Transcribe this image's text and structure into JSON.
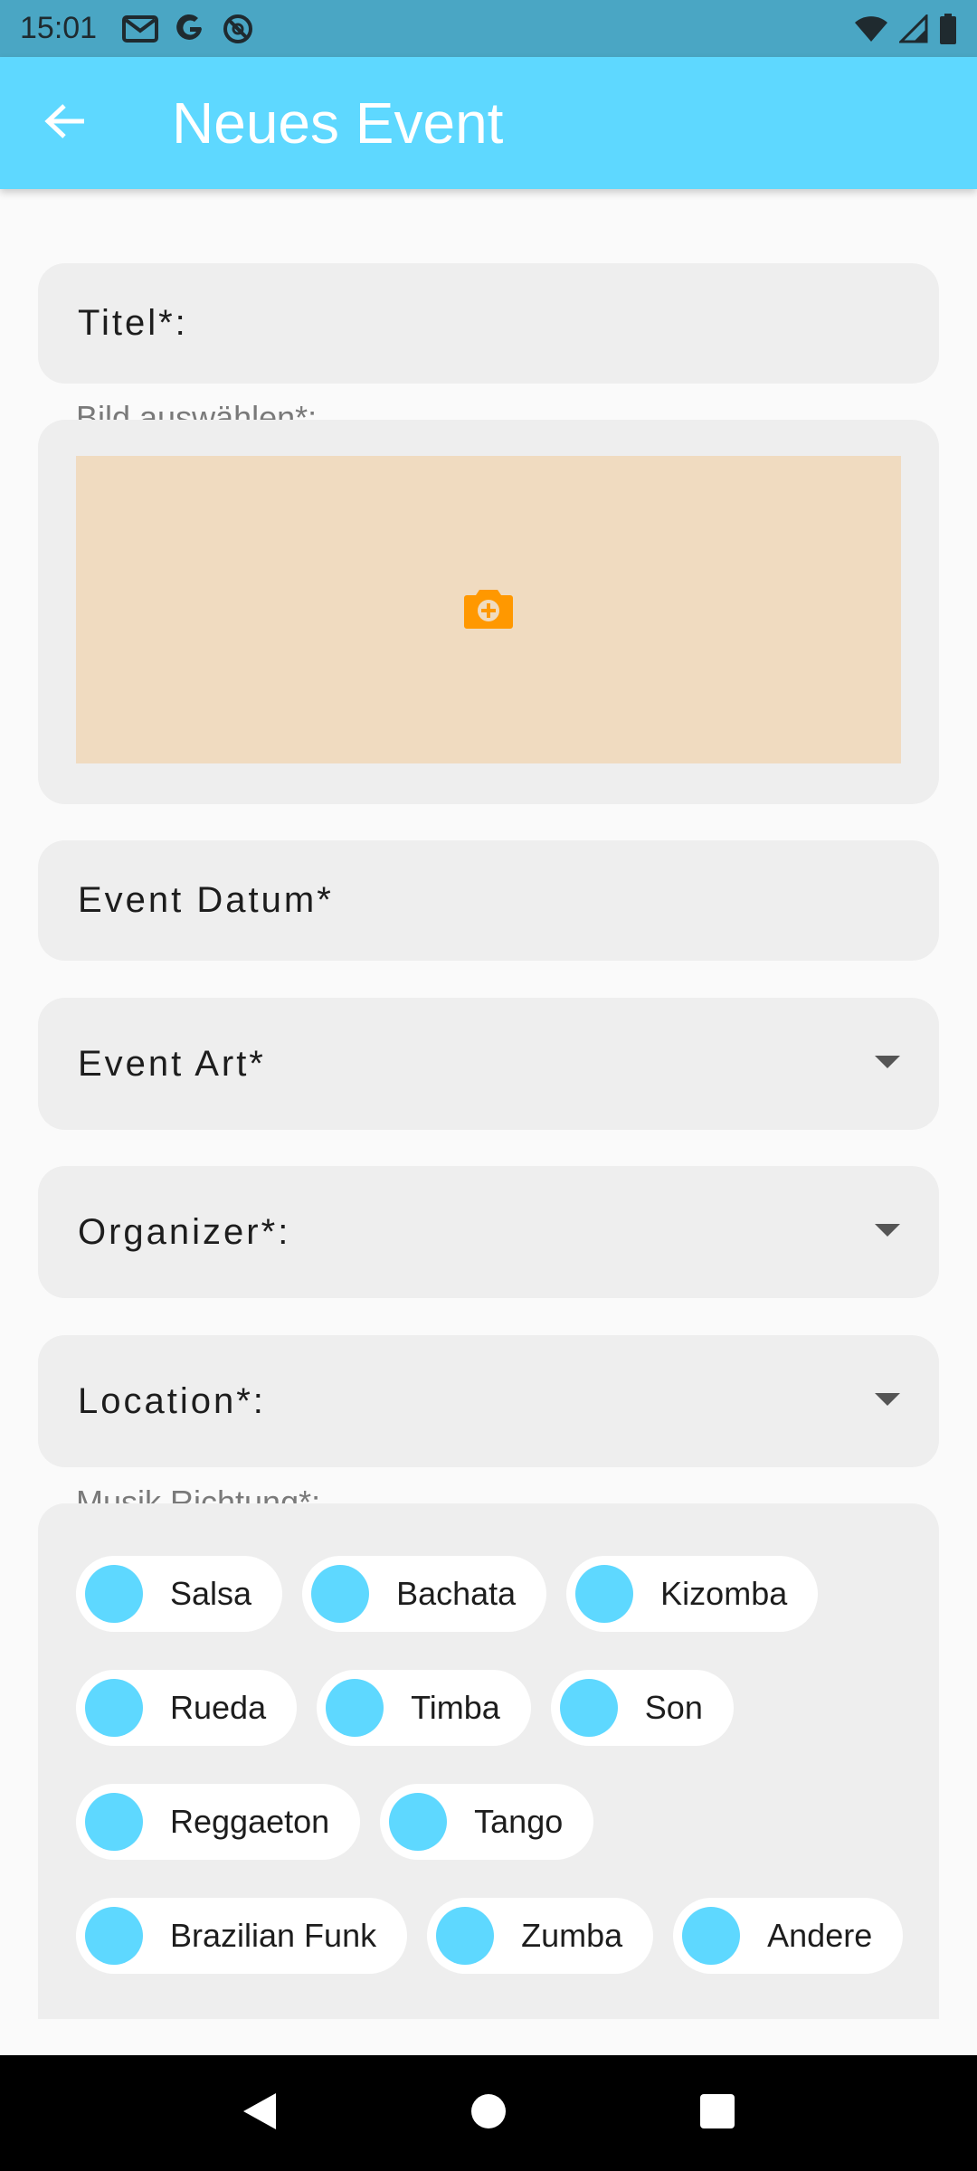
{
  "status_bar": {
    "time": "15:01",
    "left_icons": [
      "gmail-icon",
      "google-icon",
      "at-sign-icon"
    ],
    "right_icons": [
      "wifi-icon",
      "signal-icon",
      "battery-icon"
    ]
  },
  "app_bar": {
    "title": "Neues Event",
    "back_icon": "arrow-left-icon"
  },
  "form": {
    "title_label": "Titel*:",
    "image_label": "Bild auswählen*:",
    "image_icon": "add-photo-camera-icon",
    "date_label": "Event Datum*",
    "type_label": "Event Art*",
    "organizer_label": "Organizer*:",
    "location_label": "Location*:",
    "music_label": "Musik Richtung*:",
    "music_styles": [
      [
        "Salsa",
        "Bachata",
        "Kizomba"
      ],
      [
        "Rueda",
        "Timba",
        "Son"
      ],
      [
        "Reggaeton",
        "Tango"
      ],
      [
        "Brazilian Funk",
        "Zumba",
        "Andere"
      ]
    ]
  },
  "colors": {
    "accent": "#5ed8ff",
    "status_bar": "#4aa6c4",
    "image_placeholder": "#f0dbc0",
    "camera_icon": "#ff9800"
  },
  "nav_bar": {
    "buttons": [
      "back-triangle-icon",
      "home-circle-icon",
      "recents-square-icon"
    ]
  }
}
